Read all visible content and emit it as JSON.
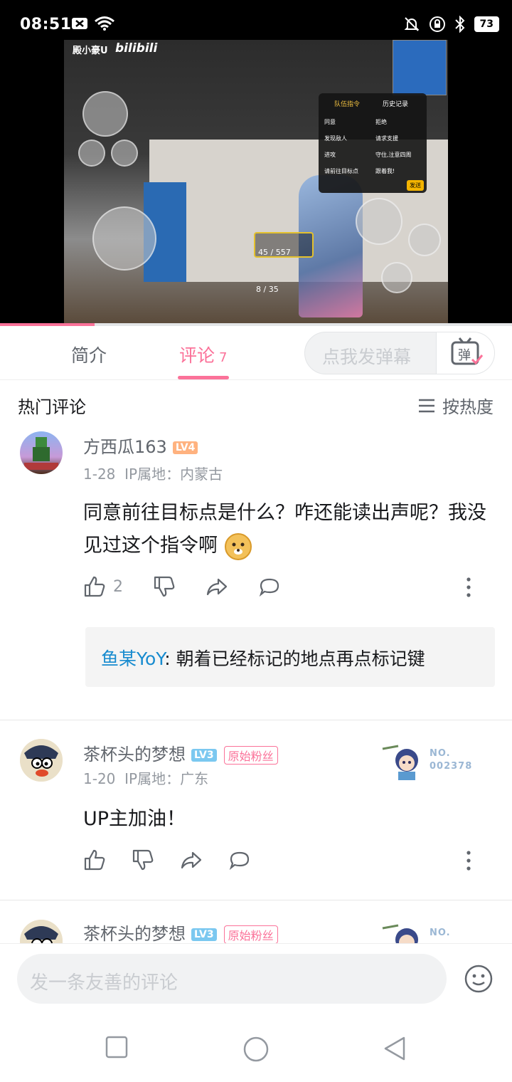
{
  "status_bar": {
    "time": "08:51",
    "battery": "73"
  },
  "video": {
    "overlay_name": "殿小豪U",
    "overlay_brand": "bilibili",
    "panel_tab_1": "队伍指令",
    "panel_tab_2": "历史记录",
    "panel_items": [
      "同意",
      "拒绝",
      "发现敌人",
      "请求支援",
      "进攻",
      "守住,注意四周",
      "请前往目标点",
      "跟着我!"
    ],
    "panel_send": "发送",
    "weapon_ammo": "45 / 557",
    "secondary_ammo": "8 / 35",
    "progress_percent": 18.5
  },
  "tabs": {
    "intro_label": "简介",
    "comments_label": "评论",
    "comments_count": "7"
  },
  "danmaku": {
    "placeholder": "点我发弹幕",
    "button_icon": "弹"
  },
  "comments_header": {
    "title": "热门评论",
    "sort_label": "按热度"
  },
  "comments": [
    {
      "user": "方西瓜163",
      "level": "LV4",
      "date": "1-28",
      "ip": "IP属地：内蒙古",
      "text": "同意前往目标点是什么？咋还能读出声呢？我没见过这个指令啊",
      "likes": "2",
      "reply": {
        "user": "鱼某YoY",
        "text": "朝着已经标记的地点再点标记键"
      }
    },
    {
      "user": "茶杯头的梦想",
      "level": "LV3",
      "fan_badge": "原始粉丝",
      "date": "1-20",
      "ip": "IP属地：广东",
      "text": "UP主加油！",
      "decor_no_label": "NO.",
      "decor_no_value": "002378"
    },
    {
      "user": "茶杯头的梦想",
      "level": "LV3",
      "fan_badge": "原始粉丝",
      "decor_no_label": "NO."
    }
  ],
  "bottom_input": {
    "placeholder": "发一条友善的评论"
  },
  "colors": {
    "accent": "#fb7299",
    "reply_user": "#178bcf",
    "text_secondary": "#61666d",
    "text_muted": "#9499a0"
  }
}
